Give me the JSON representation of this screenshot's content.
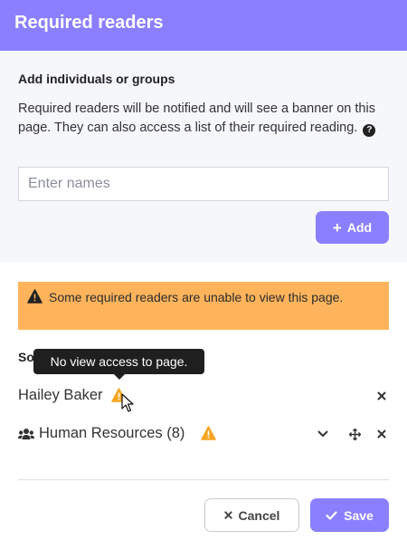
{
  "header": {
    "title": "Required readers"
  },
  "add_section": {
    "title": "Add individuals or groups",
    "description": "Required readers will be notified and will see a banner on this page. They can also access a list of their required reading.",
    "help_icon": "question-circle-icon",
    "input_placeholder": "Enter names",
    "input_value": "",
    "add_label": "Add"
  },
  "warning": {
    "text": "Some required readers are unable to view this page.",
    "color": "#ffb45c",
    "icon": "warning-triangle-icon"
  },
  "list": {
    "heading": "So",
    "tooltip": "No view access to page.",
    "readers": [
      {
        "name": "Hailey Baker",
        "type": "user",
        "warning": true
      },
      {
        "name": "Human Resources (8)",
        "type": "group",
        "warning": true
      }
    ]
  },
  "footer": {
    "cancel_label": "Cancel",
    "save_label": "Save"
  },
  "colors": {
    "accent": "#8a80ff",
    "warning": "#ffb45c",
    "warning_icon": "#f5a623"
  }
}
